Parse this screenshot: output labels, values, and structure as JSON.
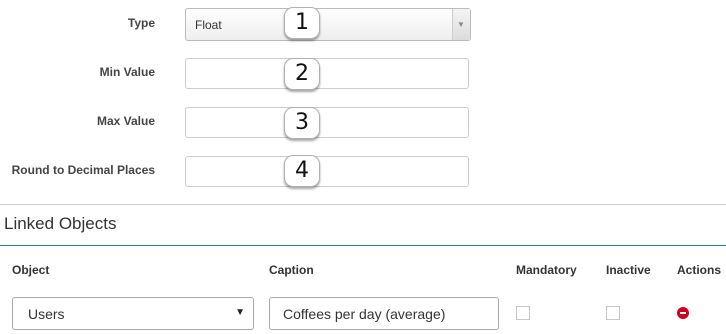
{
  "form": {
    "type": {
      "label": "Type",
      "value": "Float",
      "badge": "1"
    },
    "min_value": {
      "label": "Min Value",
      "value": "",
      "badge": "2"
    },
    "max_value": {
      "label": "Max Value",
      "value": "",
      "badge": "3"
    },
    "round_decimal": {
      "label": "Round to Decimal Places",
      "value": "",
      "badge": "4"
    }
  },
  "linked_objects": {
    "title": "Linked Objects",
    "columns": {
      "object": "Object",
      "caption": "Caption",
      "mandatory": "Mandatory",
      "inactive": "Inactive",
      "actions": "Actions"
    },
    "rows": [
      {
        "object": "Users",
        "caption": "Coffees per day (average)",
        "mandatory": false,
        "inactive": false
      }
    ]
  },
  "colors": {
    "section_rule": "#2a7fa8",
    "remove_icon": "#d0021b"
  },
  "icons": {
    "select_arrow": "triangle-down",
    "remove": "minus-circle"
  }
}
